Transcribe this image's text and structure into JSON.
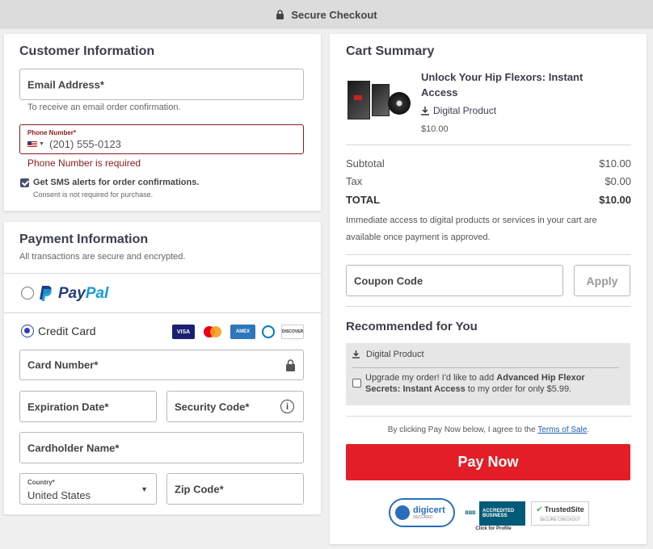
{
  "topbar": {
    "title": "Secure Checkout",
    "icon": "lock-icon"
  },
  "customer": {
    "heading": "Customer Information",
    "email_label": "Email Address*",
    "email_hint": "To receive an email order confirmation.",
    "phone_label": "Phone Number*",
    "phone_placeholder": "(201) 555-0123",
    "phone_error": "Phone Number is required",
    "sms_label": "Get SMS alerts for order confirmations.",
    "sms_consent": "Consent is not required for purchase."
  },
  "payment": {
    "heading": "Payment Information",
    "subheading": "All transactions are secure and encrypted.",
    "paypal_label": "PayPal",
    "paypal_brand_p": "Pay",
    "paypal_brand_pal": "Pal",
    "credit_label": "Credit Card",
    "card_logos": [
      "VISA",
      "MC",
      "AMEX",
      "DC",
      "DISCOVER"
    ],
    "card_number_label": "Card Number*",
    "expiration_label": "Expiration Date*",
    "security_label": "Security Code*",
    "cardholder_label": "Cardholder Name*",
    "country_label": "Country*",
    "country_value": "United States",
    "zip_label": "Zip Code*"
  },
  "cart": {
    "heading": "Cart Summary",
    "product_title": "Unlock Your Hip Flexors: Instant Access",
    "product_type": "Digital Product",
    "product_price": "$10.00",
    "subtotal_label": "Subtotal",
    "subtotal_value": "$10.00",
    "tax_label": "Tax",
    "tax_value": "$0.00",
    "total_label": "TOTAL",
    "total_value": "$10.00",
    "access_note": "Immediate access to digital products or services in your cart are available once payment is approved.",
    "coupon_label": "Coupon Code",
    "apply_label": "Apply"
  },
  "recommended": {
    "heading": "Recommended for You",
    "type": "Digital Product",
    "text_pre": "Upgrade my order! I'd like to add ",
    "text_bold": "Advanced Hip Flexor Secrets: Instant Access",
    "text_post": " to my order for only $5.99."
  },
  "terms": {
    "pre": "By clicking Pay Now below, I agree to the ",
    "link": "Terms of Sale",
    "post": "."
  },
  "paynow_label": "Pay Now",
  "badges": {
    "digicert": "digicert",
    "digicert_sub": "SECURED",
    "bbb_top": "ACCREDITED",
    "bbb_bottom": "BUSINESS",
    "bbb_caption": "Click for Profile",
    "trusted": "TrustedSite",
    "trusted_sub": "SECURE CHECKOUT"
  },
  "colors": {
    "accent": "#e41e26",
    "error": "#8b1a1a",
    "radio": "#2a3fb8",
    "paypal_dark": "#253b80",
    "paypal_light": "#179bd7"
  }
}
